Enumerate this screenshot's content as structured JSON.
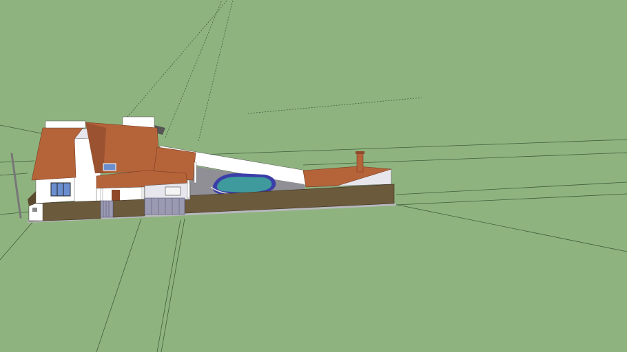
{
  "viewport": {
    "background_color": "#8fb37f",
    "guide_line_color": "#3f5e3a"
  },
  "scene": {
    "subject": "3d-house-model",
    "colors": {
      "roof": "#b5643a",
      "roof_dark": "#8e4a2a",
      "wall": "#ffffff",
      "wall_shade": "#e6e6ec",
      "stone_wall": "#6b5a3c",
      "paving": "#8f8f95",
      "pool_water": "#3f9a9e",
      "pool_rim": "#3b3ea8",
      "window": "#6a8ed0",
      "chimney": "#b5643a"
    }
  }
}
